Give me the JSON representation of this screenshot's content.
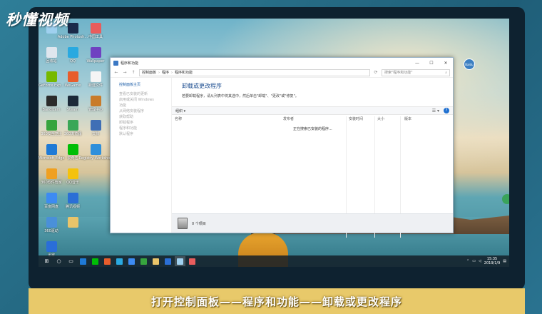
{
  "watermark": "秒懂视频",
  "subtitle": "打开控制面板——程序和功能——卸载或更改程序",
  "desktop": {
    "icons_col1": [
      {
        "label": "",
        "icon": "this-pc-icon",
        "color": "#9fd0ef"
      },
      {
        "label": "回收站",
        "icon": "recycle-bin-icon",
        "color": "#dfe6ee"
      },
      {
        "label": "GeForce Exp...",
        "icon": "geforce-icon",
        "color": "#76b900"
      },
      {
        "label": "Bandicam",
        "icon": "bandicam-icon",
        "color": "#2b2b2b"
      },
      {
        "label": "360安全卫士",
        "icon": "360-safe-icon",
        "color": "#37a43e"
      },
      {
        "label": "Microsoft Edge",
        "icon": "edge-icon",
        "color": "#1f7ad6"
      },
      {
        "label": "360软件管家",
        "icon": "360-software-icon",
        "color": "#f0a020"
      },
      {
        "label": "百度网盘",
        "icon": "baidu-netdisk-icon",
        "color": "#3d8bf2"
      },
      {
        "label": "360驱动",
        "icon": "driver-icon",
        "color": "#4a90d9"
      },
      {
        "label": "迅雷",
        "icon": "xunlei-icon",
        "color": "#2a6ed8"
      }
    ],
    "icons_col2": [
      {
        "label": "Adobe Photosh...",
        "icon": "photoshop-icon",
        "color": "#1b2a4a"
      },
      {
        "label": "QQ",
        "icon": "qq-icon",
        "color": "#2aa9e0"
      },
      {
        "label": "WeGame",
        "icon": "wegame-icon",
        "color": "#e85d2c"
      },
      {
        "label": "Steam",
        "icon": "steam-icon",
        "color": "#1b2838"
      },
      {
        "label": "360浏览器",
        "icon": "browser-360-icon",
        "color": "#3aa757"
      },
      {
        "label": "爱奇艺",
        "icon": "iqiyi-icon",
        "color": "#00be06"
      },
      {
        "label": "QQ音乐",
        "icon": "qqmusic-icon",
        "color": "#f4c20d"
      },
      {
        "label": "腾讯视频",
        "icon": "tencent-video-icon",
        "color": "#2b6fd6"
      },
      {
        "label": "",
        "icon": "folder-icon",
        "color": "#e9c46a"
      }
    ],
    "icons_col3": [
      {
        "label": "中国工具",
        "icon": "tool-icon",
        "color": "#e85d5d"
      },
      {
        "label": "Wallpaper",
        "icon": "wallpaper-icon",
        "color": "#6f42c1"
      },
      {
        "label": "新建文件",
        "icon": "file-icon",
        "color": "#f5f5f5"
      },
      {
        "label": "管理中心",
        "icon": "manage-icon",
        "color": "#c97b2a"
      },
      {
        "label": "文档",
        "icon": "doc-icon",
        "color": "#3f6fb5"
      },
      {
        "label": "Registry Workshop",
        "icon": "registry-icon",
        "color": "#2f8fdb"
      }
    ],
    "user_badge": "Baidu"
  },
  "window": {
    "title": "程序和功能",
    "address": [
      "控制面板",
      "程序",
      "程序和功能"
    ],
    "search_placeholder": "搜索\"程序和功能\"",
    "nav": {
      "back": "←",
      "forward": "→",
      "up": "↑",
      "refresh": "⟳"
    },
    "controls": {
      "minimize": "—",
      "maximize": "☐",
      "close": "✕"
    },
    "left_nav": {
      "home": "控制面板主页",
      "items": [
        "查看已安装的更新",
        "启用或关闭 Windows",
        "功能",
        "从网络安装程序",
        "",
        "获取帮助",
        "卸载程序",
        "程序和功能",
        "默认程序"
      ]
    },
    "heading": "卸载或更改程序",
    "description": "若要卸载程序，请从列表中将其选中，然后单击\"卸载\"、\"更改\"或\"修复\"。",
    "toolbar": {
      "organize": "组织 ▾",
      "view": "☰ ▾",
      "help": "?"
    },
    "columns": [
      "名称",
      "发布者",
      "安装时间",
      "大小",
      "版本"
    ],
    "loading_text": "正在搜索已安装的程序...",
    "status": "0 个项目"
  },
  "taskbar": {
    "items": [
      {
        "name": "start-button",
        "glyph": "⊞",
        "color": ""
      },
      {
        "name": "search-button",
        "glyph": "○",
        "color": ""
      },
      {
        "name": "task-view-button",
        "glyph": "▭",
        "color": ""
      },
      {
        "name": "taskbar-app-1",
        "glyph": "",
        "color": "#1f7ad6"
      },
      {
        "name": "taskbar-app-2",
        "glyph": "",
        "color": "#00be06"
      },
      {
        "name": "taskbar-app-3",
        "glyph": "",
        "color": "#e85d2c"
      },
      {
        "name": "taskbar-app-4",
        "glyph": "",
        "color": "#2aa9e0"
      },
      {
        "name": "taskbar-app-5",
        "glyph": "",
        "color": "#3d8bf2"
      },
      {
        "name": "taskbar-app-6",
        "glyph": "",
        "color": "#37a43e"
      },
      {
        "name": "taskbar-app-7",
        "glyph": "",
        "color": "#e9c46a"
      },
      {
        "name": "taskbar-app-8",
        "glyph": "",
        "color": "#2b6fd6"
      },
      {
        "name": "taskbar-app-active",
        "glyph": "",
        "color": "#9fd0ef"
      },
      {
        "name": "taskbar-app-9",
        "glyph": "",
        "color": "#e85d5d"
      }
    ],
    "time": "15:35",
    "date": "2019/1/9"
  }
}
